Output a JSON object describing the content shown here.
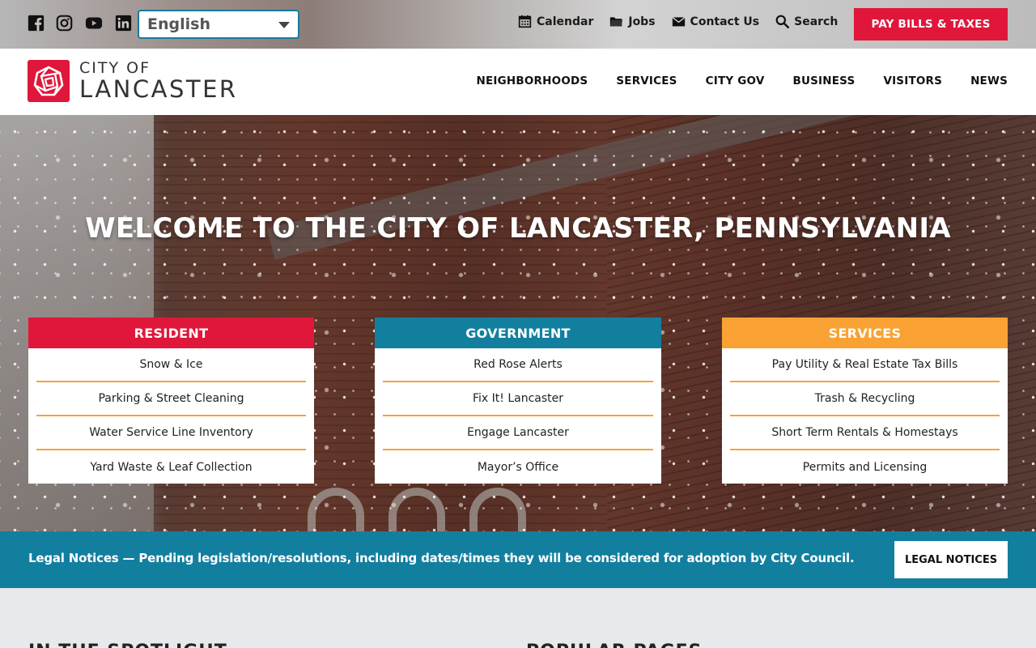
{
  "utility": {
    "social": [
      {
        "name": "facebook",
        "icon": "facebook-icon"
      },
      {
        "name": "instagram",
        "icon": "instagram-icon"
      },
      {
        "name": "youtube",
        "icon": "youtube-icon"
      },
      {
        "name": "linkedin",
        "icon": "linkedin-icon"
      }
    ],
    "language": {
      "selected": "English"
    },
    "links": [
      {
        "label": "Calendar",
        "icon": "calendar-icon"
      },
      {
        "label": "Jobs",
        "icon": "folder-icon"
      },
      {
        "label": "Contact Us",
        "icon": "envelope-icon"
      },
      {
        "label": "Search",
        "icon": "search-icon"
      }
    ],
    "pay_label": "PAY BILLS & TAXES"
  },
  "header": {
    "logo_top": "CITY OF",
    "logo_bottom": "LANCASTER",
    "nav": [
      "NEIGHBORHOODS",
      "SERVICES",
      "CITY GOV",
      "BUSINESS",
      "VISITORS",
      "NEWS"
    ]
  },
  "hero": {
    "title": "WELCOME TO THE CITY OF LANCASTER, PENNSYLVANIA",
    "cards": [
      {
        "title": "RESIDENT",
        "color": "#e0173a",
        "items": [
          "Snow & Ice",
          "Parking & Street Cleaning",
          "Water Service Line Inventory",
          "Yard Waste & Leaf Collection"
        ]
      },
      {
        "title": "GOVERNMENT",
        "color": "#137f9f",
        "items": [
          "Red Rose Alerts",
          "Fix It! Lancaster",
          "Engage Lancaster",
          "Mayor’s Office"
        ]
      },
      {
        "title": "SERVICES",
        "color": "#f9a233",
        "items": [
          "Pay Utility & Real Estate Tax Bills",
          "Trash & Recycling",
          "Short Term Rentals & Homestays",
          "Permits and Licensing"
        ]
      }
    ]
  },
  "legal": {
    "text": "Legal Notices — Pending legislation/resolutions, including dates/times they will be considered for adoption by City Council.",
    "button": "LEGAL NOTICES"
  },
  "bottom": {
    "left_heading": "IN THE SPOTLIGHT",
    "right_heading": "POPULAR PAGES"
  },
  "colors": {
    "brand_red": "#e0173a",
    "brand_teal": "#137f9f",
    "brand_orange": "#f9a233"
  }
}
